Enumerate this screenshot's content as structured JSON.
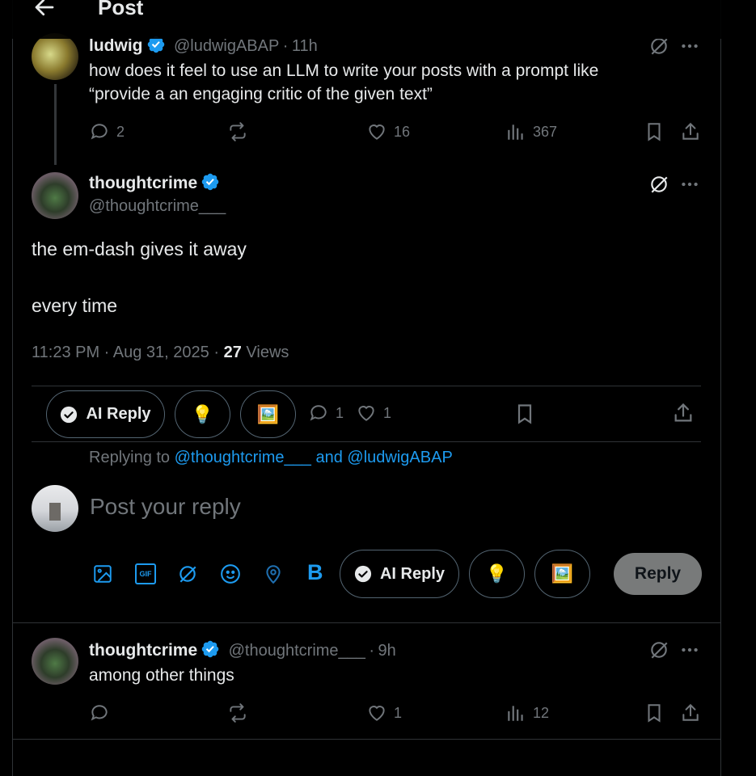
{
  "header": {
    "title": "Post"
  },
  "parent_post": {
    "name": "ludwig",
    "handle": "@ludwigABAP",
    "time": "11h",
    "text_line1": "how does it feel to use an LLM to write your posts with a prompt like",
    "text_line2": "“provide a an engaging critic of the given text”",
    "replies": "2",
    "likes": "16",
    "views": "367"
  },
  "main_post": {
    "name": "thoughtcrime",
    "handle": "@thoughtcrime___",
    "line1": "the em-dash gives it away",
    "line2": "every time",
    "timestamp": "11:23 PM · Aug 31, 2025",
    "sep": "·",
    "views_count": "27",
    "views_label": "Views",
    "ai_reply_label": "AI Reply",
    "replies": "1",
    "likes": "1"
  },
  "composer": {
    "replying_prefix": "Replying to",
    "mention1": "@thoughtcrime___",
    "and": "and",
    "mention2": "@ludwigABAP",
    "placeholder": "Post your reply",
    "bold_label": "B",
    "gif_label": "GIF",
    "ai_reply_label": "AI Reply",
    "reply_button": "Reply"
  },
  "reply_post": {
    "name": "thoughtcrime",
    "handle": "@thoughtcrime___",
    "time": "9h",
    "text": "among other things",
    "likes": "1",
    "views": "12"
  },
  "icons": {
    "back": "arrow-left-icon",
    "verified": "verified-badge-icon",
    "grok": "grok-icon",
    "more": "more-icon",
    "reply": "reply-icon",
    "repost": "repost-icon",
    "like": "heart-icon",
    "views": "views-icon",
    "bookmark": "bookmark-icon",
    "share": "share-icon"
  },
  "colors": {
    "accent": "#1d9bf0",
    "background": "#000000",
    "muted": "#71767b"
  }
}
